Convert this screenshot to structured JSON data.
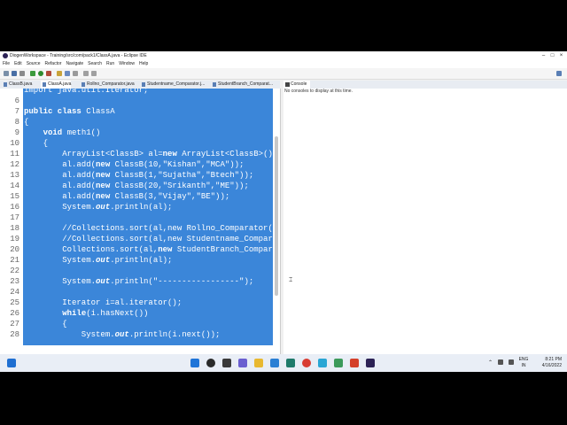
{
  "window": {
    "title": "DiogenWorkspace - Training/src/com/pack1/ClassA.java - Eclipse IDE",
    "controls": [
      "–",
      "□",
      "×"
    ]
  },
  "menu": [
    "File",
    "Edit",
    "Source",
    "Refactor",
    "Navigate",
    "Search",
    "Run",
    "Window",
    "Help"
  ],
  "editor_tabs": [
    "ClassB.java",
    "ClassA.java",
    "Rollno_Comparator.java",
    "Studentname_Comparator.j...",
    "StudentBranch_Comparat..."
  ],
  "console": {
    "tab": "Console",
    "message": "No consoles to display at this time."
  },
  "code": [
    {
      "num": "",
      "parts": [
        {
          "t": "import java.util.Iterator;"
        }
      ]
    },
    {
      "num": "6",
      "parts": []
    },
    {
      "num": "7",
      "parts": [
        {
          "t": "public class ",
          "k": "kw"
        },
        {
          "t": "ClassA"
        }
      ]
    },
    {
      "num": "8",
      "parts": [
        {
          "t": "{"
        }
      ]
    },
    {
      "num": "9",
      "parts": [
        {
          "t": "    "
        },
        {
          "t": "void ",
          "k": "kw"
        },
        {
          "t": "meth1()"
        }
      ]
    },
    {
      "num": "10",
      "parts": [
        {
          "t": "    {"
        }
      ]
    },
    {
      "num": "11",
      "parts": [
        {
          "t": "        ArrayList<ClassB> al="
        },
        {
          "t": "new ",
          "k": "kw"
        },
        {
          "t": "ArrayList<ClassB>();"
        }
      ]
    },
    {
      "num": "12",
      "parts": [
        {
          "t": "        al.add("
        },
        {
          "t": "new ",
          "k": "kw"
        },
        {
          "t": "ClassB(10,\"Kishan\",\"MCA\"));"
        }
      ]
    },
    {
      "num": "13",
      "parts": [
        {
          "t": "        al.add("
        },
        {
          "t": "new ",
          "k": "kw"
        },
        {
          "t": "ClassB(1,\"Sujatha\",\"Btech\"));"
        }
      ]
    },
    {
      "num": "14",
      "parts": [
        {
          "t": "        al.add("
        },
        {
          "t": "new ",
          "k": "kw"
        },
        {
          "t": "ClassB(20,\"Srikanth\",\"ME\"));"
        }
      ]
    },
    {
      "num": "15",
      "parts": [
        {
          "t": "        al.add("
        },
        {
          "t": "new ",
          "k": "kw"
        },
        {
          "t": "ClassB(3,\"Vijay\",\"BE\"));"
        }
      ]
    },
    {
      "num": "16",
      "parts": [
        {
          "t": "        System."
        },
        {
          "t": "out",
          "k": "it"
        },
        {
          "t": ".println(al);"
        }
      ]
    },
    {
      "num": "17",
      "parts": []
    },
    {
      "num": "18",
      "parts": [
        {
          "t": "        //Collections.sort(al,new Rollno_Comparator());"
        }
      ]
    },
    {
      "num": "19",
      "parts": [
        {
          "t": "        //Collections.sort(al,new Studentname_Comparator());"
        }
      ]
    },
    {
      "num": "20",
      "parts": [
        {
          "t": "        Collections.sort(al,"
        },
        {
          "t": "new ",
          "k": "kw"
        },
        {
          "t": "StudentBranch_Comparator());"
        }
      ]
    },
    {
      "num": "21",
      "parts": [
        {
          "t": "        System."
        },
        {
          "t": "out",
          "k": "it"
        },
        {
          "t": ".println(al);"
        }
      ]
    },
    {
      "num": "22",
      "parts": []
    },
    {
      "num": "23",
      "parts": [
        {
          "t": "        System."
        },
        {
          "t": "out",
          "k": "it"
        },
        {
          "t": ".println(\"-----------------\");"
        }
      ]
    },
    {
      "num": "24",
      "parts": []
    },
    {
      "num": "25",
      "parts": [
        {
          "t": "        Iterator i=al.iterator();"
        }
      ]
    },
    {
      "num": "26",
      "parts": [
        {
          "t": "        "
        },
        {
          "t": "while",
          "k": "kw"
        },
        {
          "t": "(i.hasNext())"
        }
      ]
    },
    {
      "num": "27",
      "parts": [
        {
          "t": "        {"
        }
      ]
    },
    {
      "num": "28",
      "parts": [
        {
          "t": "            System."
        },
        {
          "t": "out",
          "k": "it"
        },
        {
          "t": ".println(i.next());"
        }
      ]
    }
  ],
  "taskbar": {
    "tray_lang": "ENG",
    "tray_region": "IN",
    "time": "8:21 PM",
    "date": "4/16/2022"
  },
  "colors": {
    "selection": "#3b86d9",
    "taskbar": "#e9eef6"
  }
}
